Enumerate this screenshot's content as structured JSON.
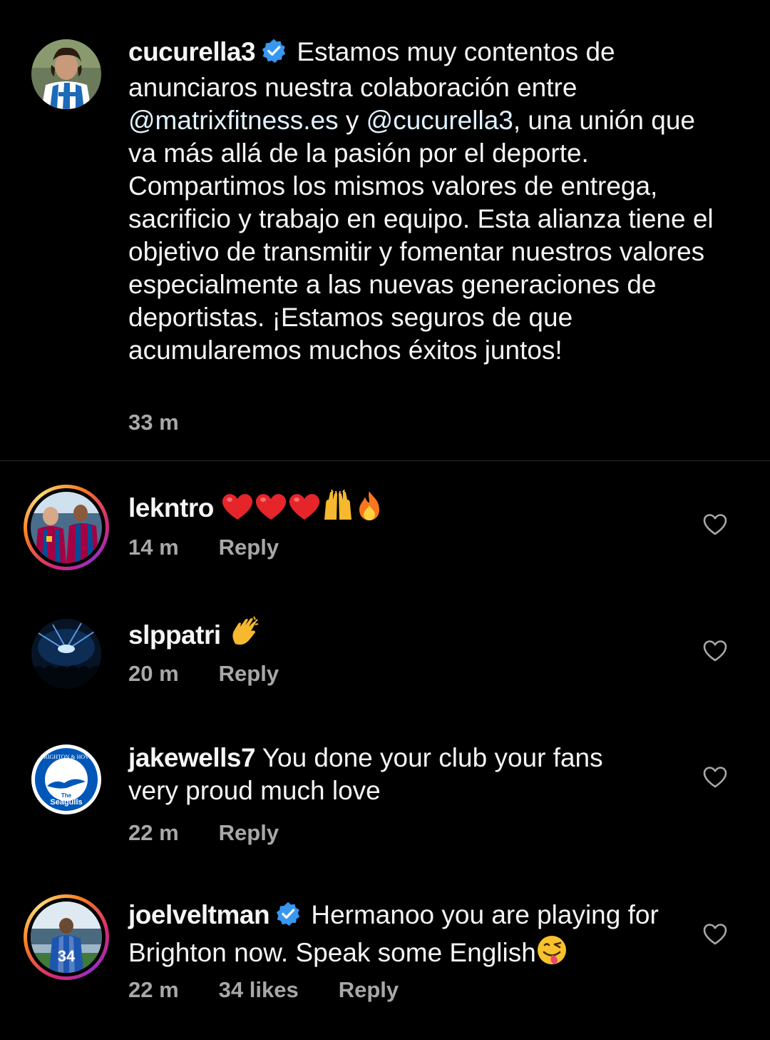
{
  "caption": {
    "username": "cucurella3",
    "verified": true,
    "text_parts": [
      {
        "text": "Estamos muy contentos de anunciaros nuestra colaboración entre ",
        "type": "plain"
      },
      {
        "text": "@matrixfitness.es",
        "type": "mention"
      },
      {
        "text": " y ",
        "type": "plain"
      },
      {
        "text": "@cucurella3",
        "type": "mention"
      },
      {
        "text": ", una unión que va más allá de la pasión por el deporte. Compartimos los mismos valores de entrega, sacrificio y trabajo en equipo. Esta alianza tiene el objetivo de transmitir y fomentar nuestros valores especialmente a las nuevas generaciones de deportistas. ¡Estamos seguros de que acumularemos muchos éxitos juntos!",
        "type": "plain"
      }
    ],
    "time": "33 m"
  },
  "comments": [
    {
      "username": "lekntro",
      "verified": false,
      "text": "",
      "emoji_names": [
        "red-heart",
        "red-heart",
        "red-heart",
        "raising-hands",
        "fire"
      ],
      "time": "14 m",
      "likes": "",
      "reply_label": "Reply",
      "avatar_ring": true
    },
    {
      "username": "slppatri",
      "verified": false,
      "text": "",
      "emoji_names": [
        "clapping-hand"
      ],
      "time": "20 m",
      "likes": "",
      "reply_label": "Reply",
      "avatar_ring": false
    },
    {
      "username": "jakewells7",
      "verified": false,
      "text": "You done your club your fans very proud much love",
      "emoji_names": [],
      "time": "22 m",
      "likes": "",
      "reply_label": "Reply",
      "avatar_ring": false,
      "avatar_badge_text": [
        "BRIGHTON & HOVE",
        "ALBION",
        "The",
        "Seagulls"
      ]
    },
    {
      "username": "joelveltman",
      "verified": true,
      "text": "Hermanoo you are playing for Brighton now. Speak some English",
      "emoji_names": [
        "winking-tongue-face"
      ],
      "time": "22 m",
      "likes": "34 likes",
      "reply_label": "Reply",
      "avatar_ring": true,
      "avatar_shirt_number": "34"
    }
  ],
  "colors": {
    "background": "#000000",
    "text": "#f5f5f5",
    "muted": "#a8a8a8",
    "verified": "#3897f0",
    "divider": "#2a2a2a"
  }
}
